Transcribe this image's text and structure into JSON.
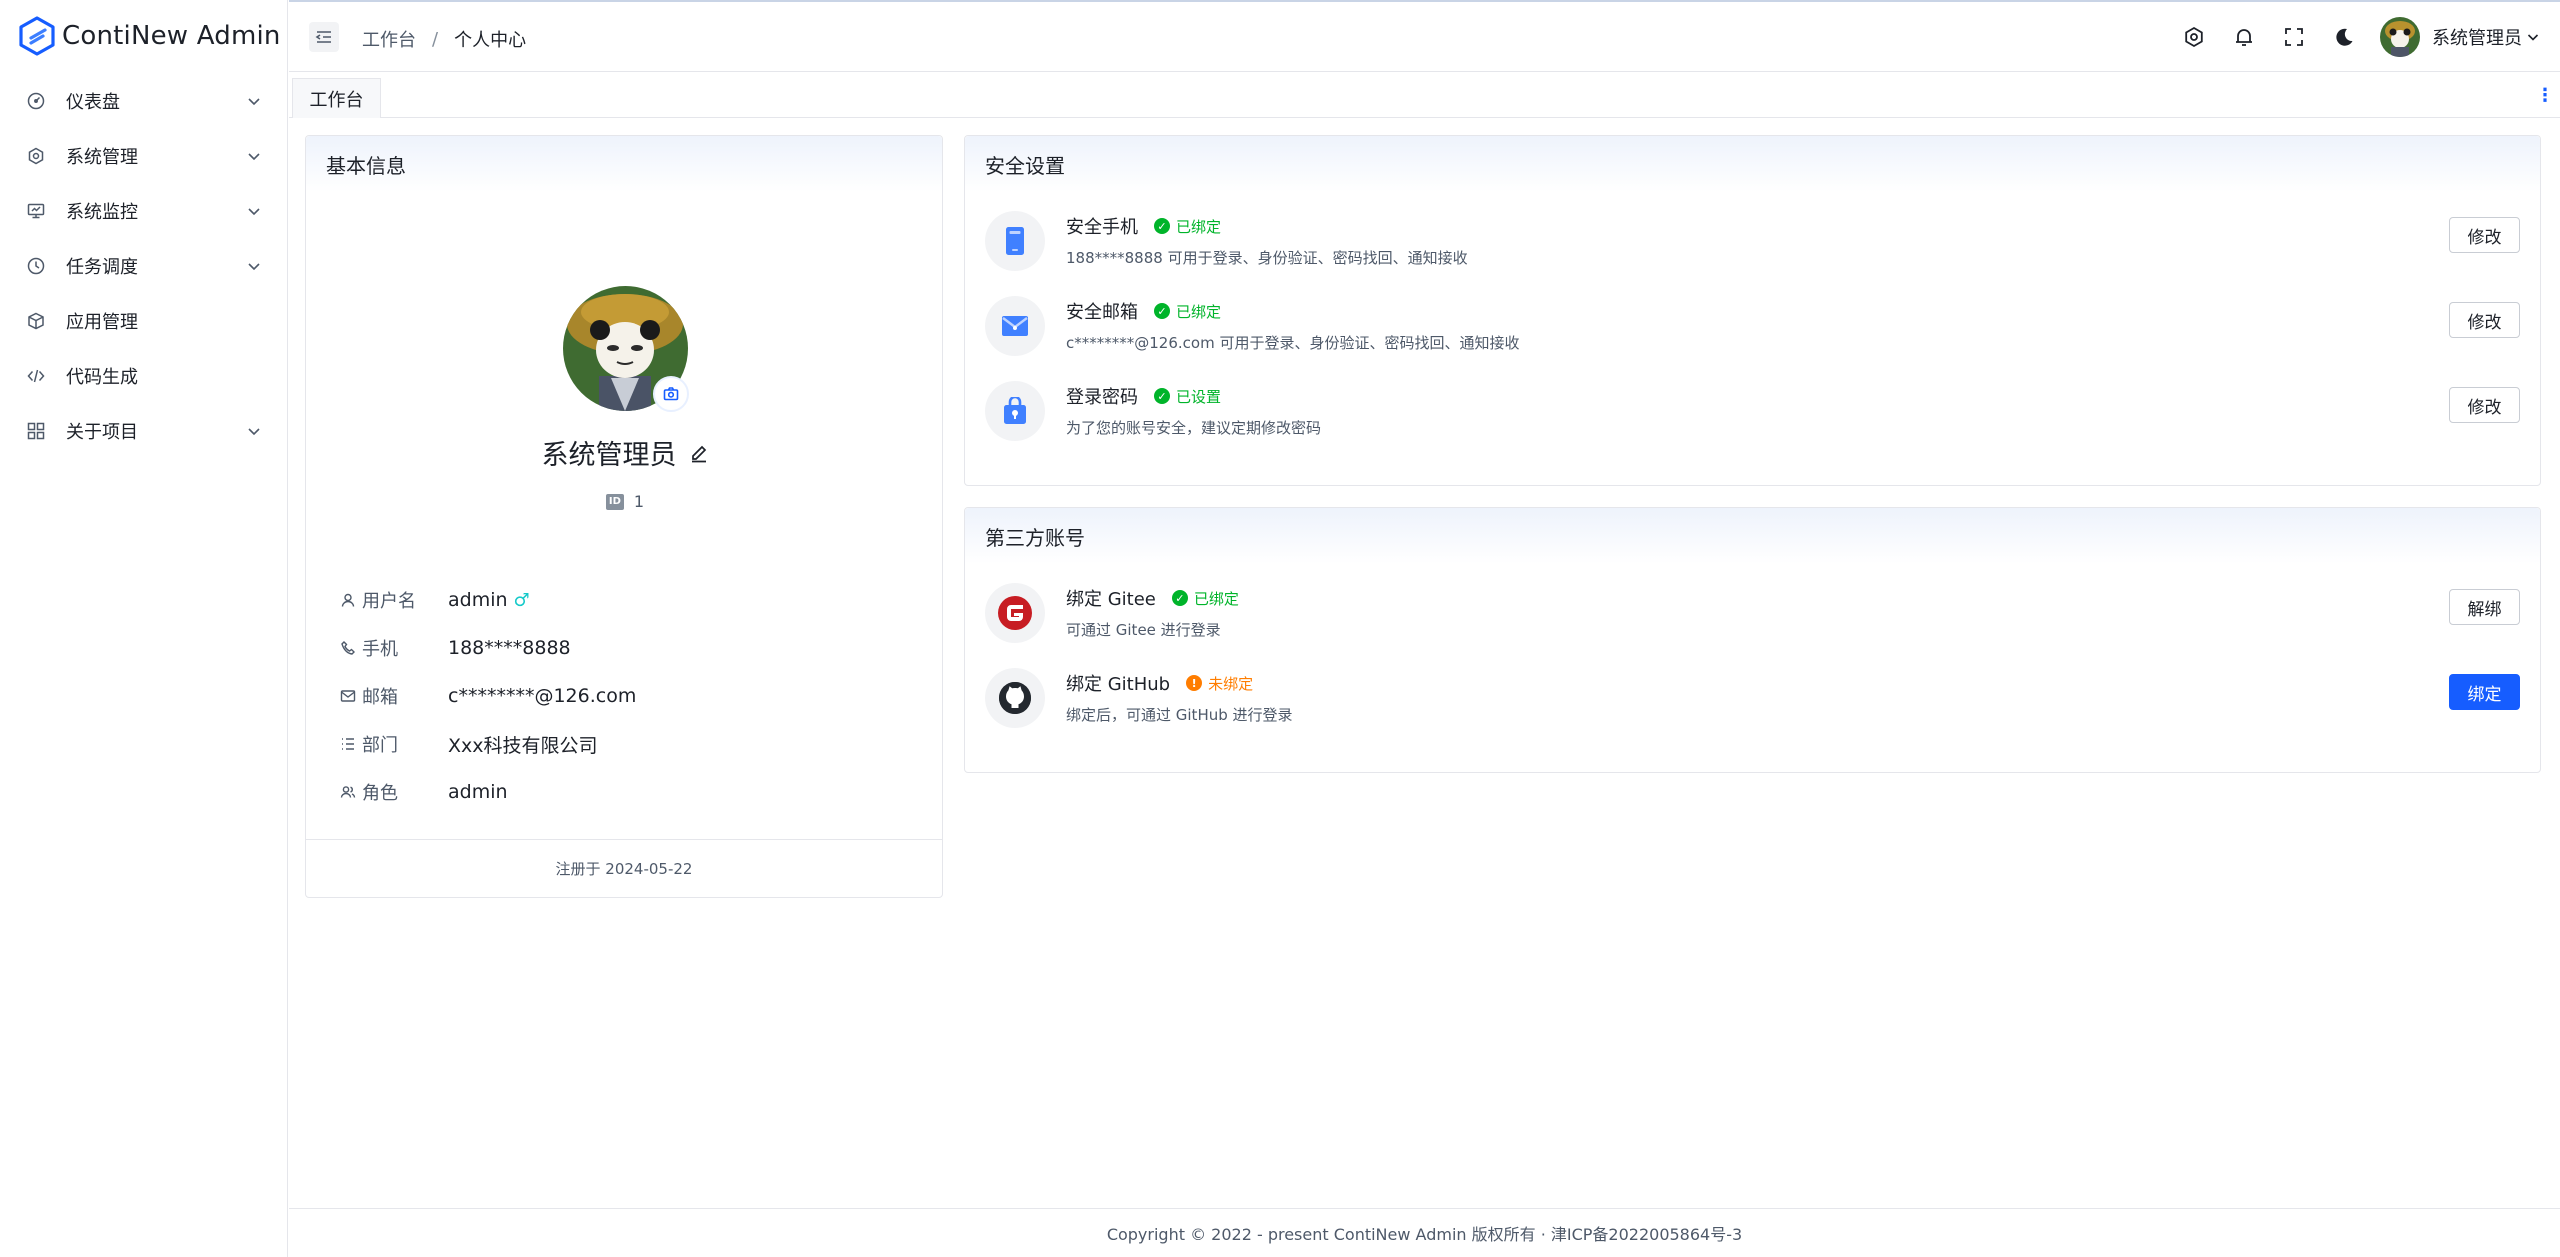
{
  "app": {
    "title": "ContiNew Admin"
  },
  "sidebar": {
    "items": [
      {
        "label": "仪表盘",
        "icon": "dashboard-icon",
        "expandable": true
      },
      {
        "label": "系统管理",
        "icon": "gear-icon",
        "expandable": true
      },
      {
        "label": "系统监控",
        "icon": "monitor-icon",
        "expandable": true
      },
      {
        "label": "任务调度",
        "icon": "clock-icon",
        "expandable": true
      },
      {
        "label": "应用管理",
        "icon": "cube-icon",
        "expandable": false
      },
      {
        "label": "代码生成",
        "icon": "code-icon",
        "expandable": false
      },
      {
        "label": "关于项目",
        "icon": "apps-icon",
        "expandable": true
      }
    ]
  },
  "header": {
    "breadcrumb": [
      "工作台",
      "个人中心"
    ],
    "breadcrumb_sep": "/",
    "username": "系统管理员"
  },
  "tabs": {
    "items": [
      "工作台"
    ],
    "more": "⋮"
  },
  "basic": {
    "title": "基本信息",
    "display_name": "系统管理员",
    "id_badge": "ID",
    "id_value": "1",
    "fields": [
      {
        "label": "用户名",
        "value": "admin",
        "icon": "user-icon"
      },
      {
        "label": "手机",
        "value": "188****8888",
        "icon": "phone-icon"
      },
      {
        "label": "邮箱",
        "value": "c********@126.com",
        "icon": "mail-icon"
      },
      {
        "label": "部门",
        "value": "Xxx科技有限公司",
        "icon": "list-icon"
      },
      {
        "label": "角色",
        "value": "admin",
        "icon": "user-group-icon"
      }
    ],
    "gender_symbol": "♂",
    "registered": "注册于 2024-05-22"
  },
  "security": {
    "title": "安全设置",
    "items": [
      {
        "title": "安全手机",
        "status": "已绑定",
        "desc": "188****8888 可用于登录、身份验证、密码找回、通知接收",
        "action": "修改"
      },
      {
        "title": "安全邮箱",
        "status": "已绑定",
        "desc": "c********@126.com 可用于登录、身份验证、密码找回、通知接收",
        "action": "修改"
      },
      {
        "title": "登录密码",
        "status": "已设置",
        "desc": "为了您的账号安全，建议定期修改密码",
        "action": "修改"
      }
    ]
  },
  "third": {
    "title": "第三方账号",
    "items": [
      {
        "title": "绑定 Gitee",
        "status": "已绑定",
        "desc": "可通过 Gitee 进行登录",
        "action": "解绑"
      },
      {
        "title": "绑定 GitHub",
        "status": "未绑定",
        "desc": "绑定后，可通过 GitHub 进行登录",
        "action": "绑定"
      }
    ]
  },
  "footer": {
    "text": "Copyright © 2022 - present ContiNew Admin 版权所有 · 津ICP备2022005864号-3"
  },
  "colors": {
    "primary": "#165dff",
    "success": "#00b42a",
    "warning": "#ff7d00",
    "gitee": "#c71d23"
  }
}
